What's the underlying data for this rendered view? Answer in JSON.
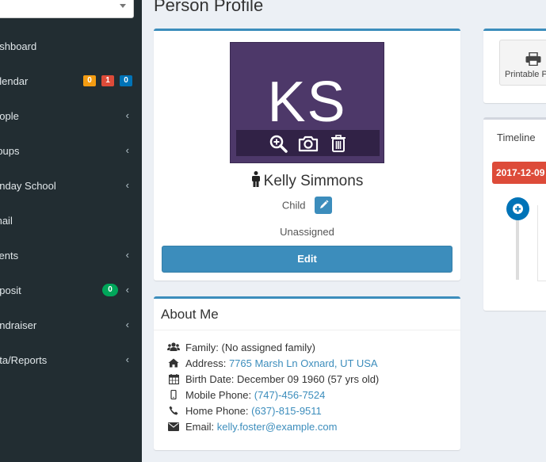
{
  "sidebar": {
    "items": [
      {
        "label": "ashboard"
      },
      {
        "label": "alendar",
        "badges": [
          {
            "text": "0",
            "color": "#f39c12"
          },
          {
            "text": "1",
            "color": "#dd4b39"
          },
          {
            "text": "0",
            "color": "#0073b7"
          }
        ]
      },
      {
        "label": "eople",
        "chevron": "‹"
      },
      {
        "label": "roups",
        "chevron": "‹"
      },
      {
        "label": "unday School",
        "chevron": "‹"
      },
      {
        "label": "mail"
      },
      {
        "label": "vents",
        "chevron": "‹"
      },
      {
        "label": "eposit",
        "badge": {
          "text": "0",
          "color": "#00a65a"
        },
        "chevron": "‹"
      },
      {
        "label": "undraiser",
        "chevron": "‹"
      },
      {
        "label": "ata/Reports",
        "chevron": "‹"
      }
    ]
  },
  "page": {
    "title": "Person Profile"
  },
  "profile": {
    "initials": "KS",
    "name": "Kelly Simmons",
    "role": "Child",
    "classification": "Unassigned",
    "edit_label": "Edit"
  },
  "about": {
    "header": "About Me",
    "family_label": "Family:",
    "family_value": "(No assigned family)",
    "address_label": "Address:",
    "address_value": "7765 Marsh Ln Oxnard, UT USA",
    "birth_label": "Birth Date:",
    "birth_value": "December 09 1960 (57 yrs old)",
    "mobile_label": "Mobile Phone:",
    "mobile_value": "(747)-456-7524",
    "home_label": "Home Phone:",
    "home_value": "(637)-815-9511",
    "email_label": "Email:",
    "email_value": "kelly.foster@example.com"
  },
  "right_panel": {
    "print_label": "Printable P",
    "tab_label": "Timeline",
    "date_label": "2017-12-09"
  },
  "colors": {
    "accent": "#3c8dbc",
    "sidebar_bg": "#222d32",
    "avatar_bg": "#4d3869",
    "danger": "#dd4b39"
  }
}
